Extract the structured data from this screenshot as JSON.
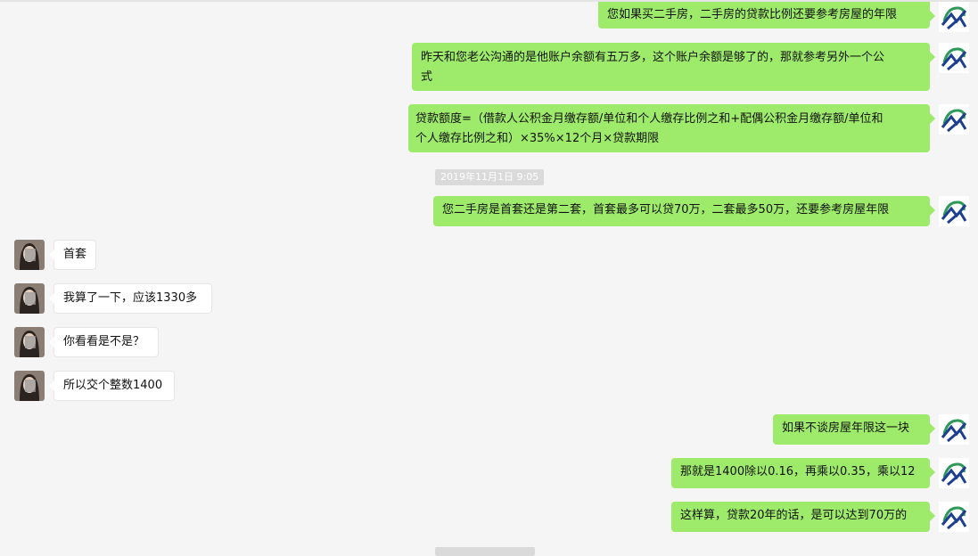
{
  "timestamps": [
    "2019年11月1日 9:05"
  ],
  "messages": [
    {
      "side": "right",
      "text": "您如果买二手房，二手房的贷款比例还要参考房屋的年限"
    },
    {
      "side": "right",
      "line1": "昨天和您老公沟通的是他账户余额有五万多，这个账户余额是够了的，那就参考另外一个公",
      "line2": "式"
    },
    {
      "side": "right",
      "line1": "贷款额度=（借款人公积金月缴存额/单位和个人缴存比例之和+配偶公积金月缴存额/单位和",
      "line2": "个人缴存比例之和）×35%×12个月×贷款期限"
    },
    {
      "side": "right",
      "text": "您二手房是首套还是第二套，首套最多可以贷70万，二套最多50万，还要参考房屋年限"
    },
    {
      "side": "left",
      "text": "首套"
    },
    {
      "side": "left",
      "text": "我算了一下，应该1330多"
    },
    {
      "side": "left",
      "text": "你看看是不是？"
    },
    {
      "side": "left",
      "text": "所以交个整数1400"
    },
    {
      "side": "right",
      "text": "如果不谈房屋年限这一块"
    },
    {
      "side": "right",
      "text": "那就是1400除以0.16，再乘以0.35，乘以12"
    },
    {
      "side": "right",
      "text": "这样算，贷款20年的话，是可以达到70万的"
    }
  ],
  "colors": {
    "bubble_me": "#9eea6a",
    "bubble_them": "#ffffff",
    "background": "#f5f5f5",
    "logo_blue": "#1e3f8f",
    "logo_green": "#2e9a5a"
  },
  "icons": {
    "agent_avatar": "logo-avatar-icon",
    "customer_avatar": "person-avatar-icon"
  }
}
